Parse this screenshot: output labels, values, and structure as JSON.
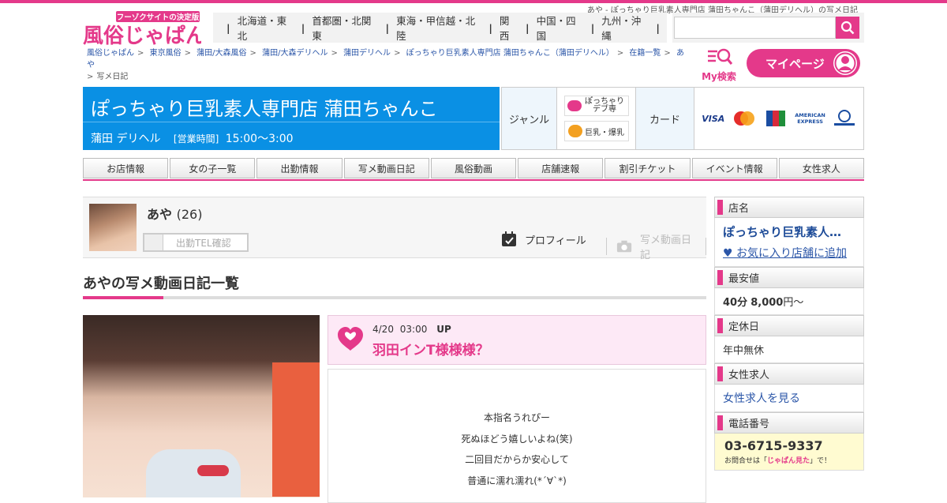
{
  "header": {
    "top_text": "あや - ぽっちゃり巨乳素人専門店 蒲田ちゃんこ（蒲田デリヘル）の写メ日記",
    "logo_tagline": "フーゾクサイトの決定版",
    "logo_text": "風俗じゃぱん!",
    "regions": [
      "北海道・東北",
      "首都圏・北関東",
      "東海・甲信越・北陸",
      "関西",
      "中国・四国",
      "九州・沖縄"
    ],
    "search_placeholder": "",
    "my_search_label": "My検索",
    "mypage_label": "マイページ"
  },
  "breadcrumb": [
    "風俗じゃぱん",
    "東京風俗",
    "蒲田/大森風俗",
    "蒲田/大森デリヘル",
    "蒲田デリヘル",
    "ぽっちゃり巨乳素人専門店 蒲田ちゃんこ（蒲田デリヘル）",
    "在籍一覧",
    "あや",
    "写メ日記"
  ],
  "shop": {
    "name": "ぽっちゃり巨乳素人専門店 蒲田ちゃんこ",
    "area_type": "蒲田 デリヘル",
    "hours_label": "[営業時間]",
    "hours": "15:00～3:00",
    "genre_label": "ジャンル",
    "genre_1": "ぽっちゃりデブ専",
    "genre_2": "巨乳・爆乳",
    "card_label": "カード",
    "cards": [
      "VISA",
      "MasterCard",
      "JCB",
      "AMERICAN EXPRESS",
      "Diners Club"
    ]
  },
  "nav": [
    "お店情報",
    "女の子一覧",
    "出勤情報",
    "写メ動画日記",
    "風俗動画",
    "店舗速報",
    "割引チケット",
    "イベント情報",
    "女性求人"
  ],
  "girl": {
    "name": "あや",
    "age": "(26)",
    "tel_button": "出勤TEL確認",
    "profile_label": "プロフィール",
    "diary_label": "写メ動画日記"
  },
  "page_title": "あやの写メ動画日記一覧",
  "post": {
    "date": "4/20",
    "time": "03:00",
    "status": "UP",
    "title": "羽田インT様様様？",
    "body": [
      "本指名うれぴー",
      "死ぬほどう嬉しいよね(笑)",
      "二回目だからか安心して",
      "普通に濡れ濡れ(*´∀`*)"
    ]
  },
  "sidebar": {
    "shop_heading": "店名",
    "shop_name": "ぽっちゃり巨乳素人…",
    "fav_link": "♥ お気に入り店舗に追加",
    "price_heading": "最安値",
    "price_time": "40分",
    "price_amount": "8,000",
    "price_unit": "円～",
    "holiday_heading": "定休日",
    "holiday": "年中無休",
    "recruit_heading": "女性求人",
    "recruit_link": "女性求人を見る",
    "tel_heading": "電話番号",
    "tel": "03-6715-9337",
    "tel_note_pre": "お問合せは「",
    "tel_note_em": "じゃぱん見た",
    "tel_note_post": "」で！"
  },
  "colors": {
    "accent": "#e4398a",
    "shop_blue": "#0a90e4",
    "link": "#2b56a8"
  }
}
